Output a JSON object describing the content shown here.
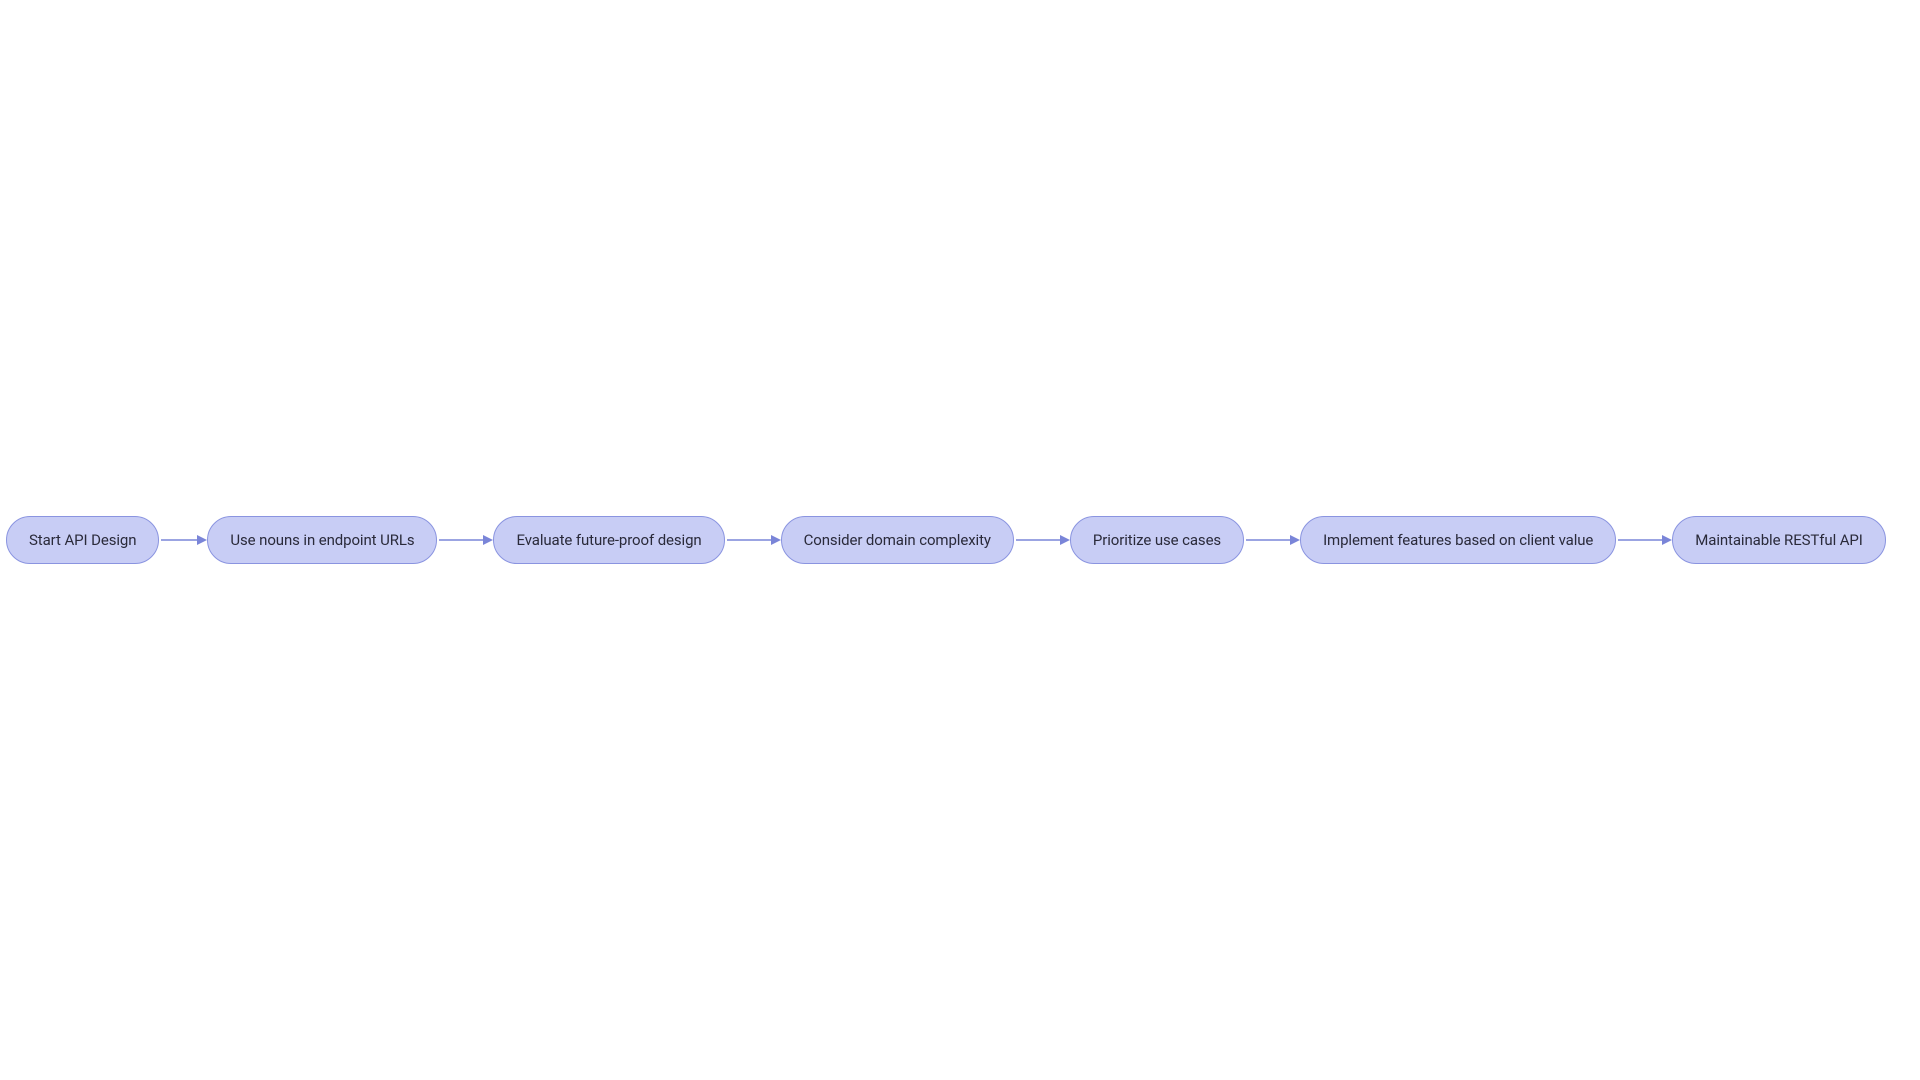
{
  "flow": {
    "nodes": [
      {
        "id": "start",
        "label": "Start API Design"
      },
      {
        "id": "nouns",
        "label": "Use nouns in endpoint URLs"
      },
      {
        "id": "futureproof",
        "label": "Evaluate future-proof design"
      },
      {
        "id": "domain",
        "label": "Consider domain complexity"
      },
      {
        "id": "usecases",
        "label": "Prioritize use cases"
      },
      {
        "id": "features",
        "label": "Implement features based on client value"
      },
      {
        "id": "maintainable",
        "label": "Maintainable RESTful API"
      }
    ],
    "colors": {
      "node_fill": "#c8cdf5",
      "node_stroke": "#8a94e0",
      "arrow_stroke": "#7a85d8",
      "arrow_fill": "#7a85d8",
      "text": "#2a2a3a"
    }
  }
}
